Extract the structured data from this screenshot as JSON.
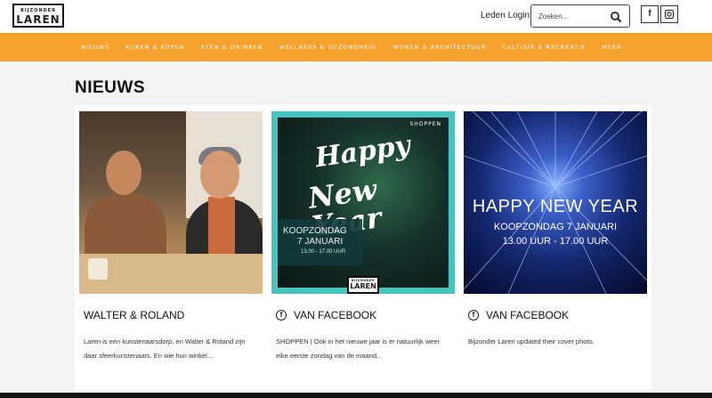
{
  "header": {
    "logo_line1": "BIJZONDER",
    "logo_line2": "LAREN",
    "login_label": "Leden Login",
    "search_placeholder": "Zoeken...",
    "social": [
      "facebook-icon",
      "instagram-icon"
    ]
  },
  "nav": {
    "items": [
      "NIEUWS",
      "KIJKEN & KOPEN",
      "ETEN & DRINKEN",
      "WELLNESS & GEZONDHEID",
      "WONEN & ARCHITECTUUR",
      "CULTUUR & RECREATIE",
      "MEER"
    ]
  },
  "colors": {
    "accent": "#f5a12b",
    "teal": "#48c4c0"
  },
  "main": {
    "heading": "NIEUWS",
    "cards": [
      {
        "title": "WALTER & ROLAND",
        "excerpt": "Laren is een kunstenaarsdorp, en Walter & Roland zijn daar sfeerkunstenaars. En wie hun winkel..."
      },
      {
        "title": "VAN FACEBOOK",
        "icon": "facebook-icon",
        "excerpt": "SHOPPEN | Ook in het nieuwe jaar is er natuurlijk weer elke eerste zondag van de maand...",
        "image": {
          "tag": "SHOPPEN",
          "happy": "Happy",
          "new_year": "New Year",
          "koop1": "KOOPZONDAG",
          "koop2": "7 JANUARI",
          "hours": "13.00 - 17.00 UUR",
          "logo_line1": "BIJZONDER",
          "logo_line2": "LAREN"
        }
      },
      {
        "title": "VAN FACEBOOK",
        "icon": "facebook-icon",
        "excerpt": "Bijzonder Laren updated their cover photo.",
        "image": {
          "line1": "HAPPY NEW YEAR",
          "line2": "KOOPZONDAG 7 JANUARI",
          "line3": "13.00 UUR - 17.00 UUR"
        }
      }
    ]
  }
}
